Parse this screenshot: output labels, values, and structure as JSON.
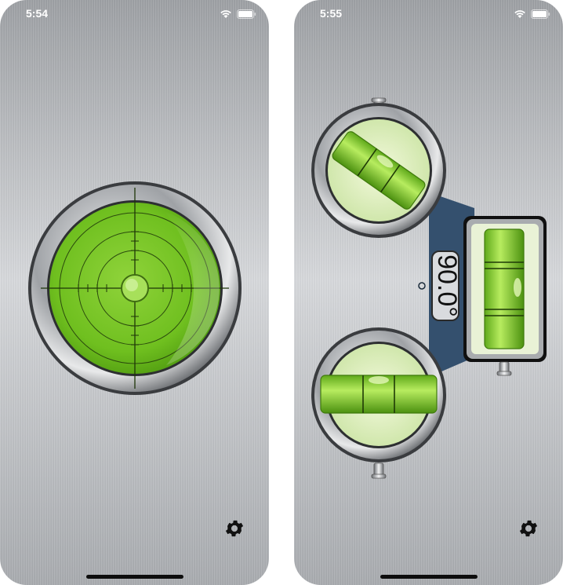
{
  "screens": [
    {
      "status_time": "5:54",
      "icons": {
        "wifi": "wifi-icon",
        "battery": "battery-icon",
        "settings": "gear-icon"
      }
    },
    {
      "status_time": "5:55",
      "angle_readout": "90.0°",
      "icons": {
        "wifi": "wifi-icon",
        "battery": "battery-icon",
        "settings": "gear-icon"
      }
    }
  ],
  "colors": {
    "bubble_green": "#7bc623",
    "bezel": "#c9cbcf",
    "panel_blue": "#34506e"
  }
}
